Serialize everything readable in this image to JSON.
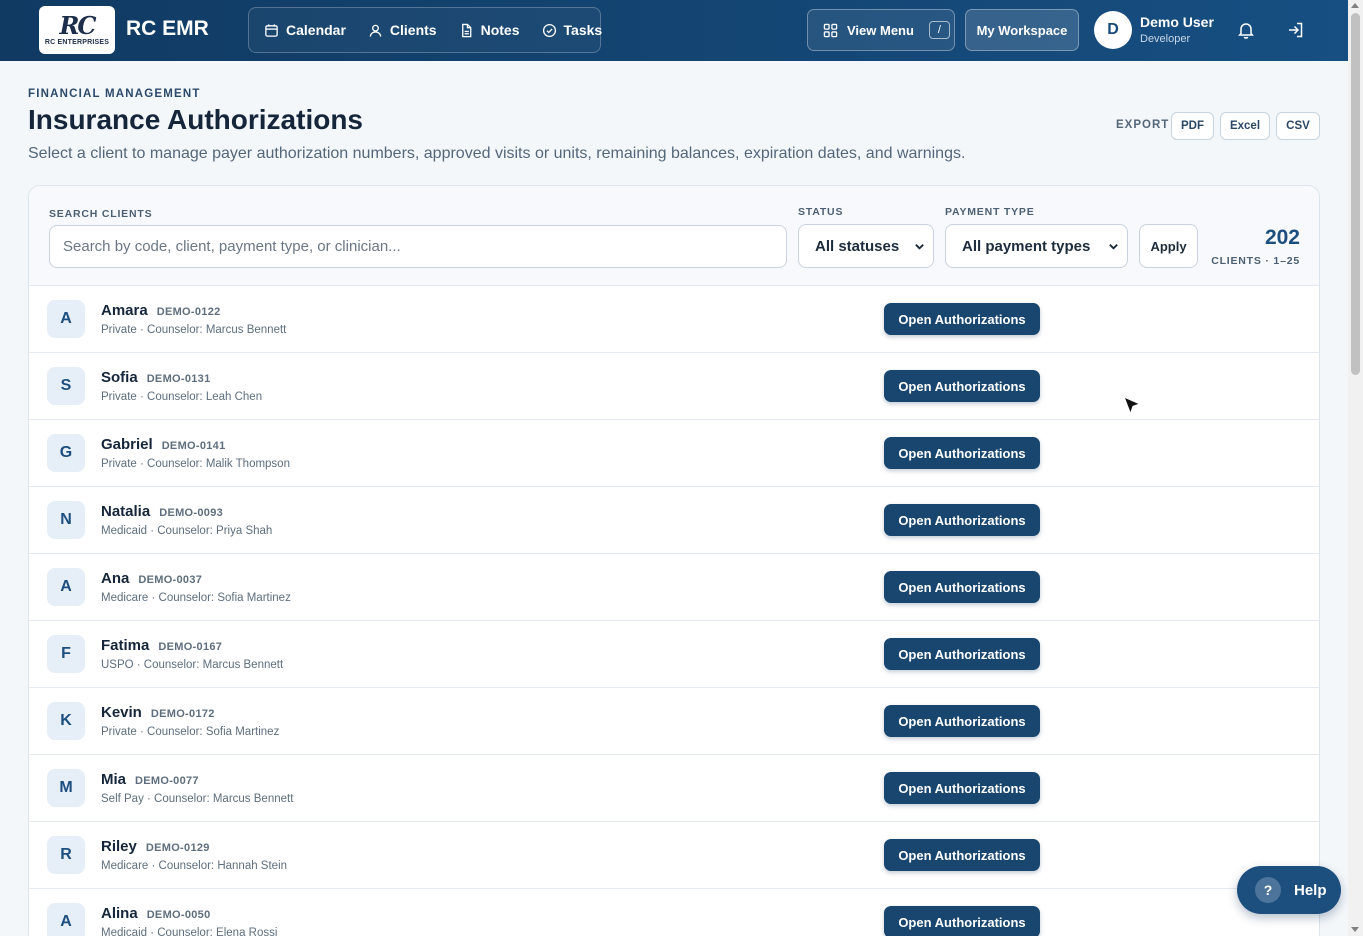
{
  "app": {
    "logo_letters": "RC",
    "logo_sub": "RC ENTERPRISES",
    "brand": "RC EMR"
  },
  "nav": {
    "items": [
      {
        "label": "Calendar",
        "icon": "calendar-icon"
      },
      {
        "label": "Clients",
        "icon": "user-icon"
      },
      {
        "label": "Notes",
        "icon": "document-icon"
      },
      {
        "label": "Tasks",
        "icon": "check-circle-icon"
      }
    ],
    "view_menu_label": "View Menu",
    "view_menu_shortcut": "/",
    "workspace_label": "My Workspace"
  },
  "user": {
    "initial": "D",
    "name": "Demo User",
    "role": "Developer"
  },
  "header": {
    "eyebrow": "FINANCIAL MANAGEMENT",
    "title": "Insurance Authorizations",
    "subtitle": "Select a client to manage payer authorization numbers, approved visits or units, remaining balances, expiration dates, and warnings.",
    "export_label": "EXPORT",
    "export_buttons": [
      "PDF",
      "Excel",
      "CSV"
    ]
  },
  "filters": {
    "search_label": "SEARCH CLIENTS",
    "search_placeholder": "Search by code, client, payment type, or clinician...",
    "status_label": "STATUS",
    "status_value": "All statuses",
    "payment_label": "PAYMENT TYPE",
    "payment_value": "All payment types",
    "apply_label": "Apply",
    "count": "202",
    "count_sub": "CLIENTS · 1–25"
  },
  "clients": [
    {
      "initial": "A",
      "name": "Amara",
      "code": "DEMO-0122",
      "meta": "Private · Counselor: Marcus Bennett"
    },
    {
      "initial": "S",
      "name": "Sofia",
      "code": "DEMO-0131",
      "meta": "Private · Counselor: Leah Chen"
    },
    {
      "initial": "G",
      "name": "Gabriel",
      "code": "DEMO-0141",
      "meta": "Private · Counselor: Malik Thompson"
    },
    {
      "initial": "N",
      "name": "Natalia",
      "code": "DEMO-0093",
      "meta": "Medicaid · Counselor: Priya Shah"
    },
    {
      "initial": "A",
      "name": "Ana",
      "code": "DEMO-0037",
      "meta": "Medicare · Counselor: Sofia Martinez"
    },
    {
      "initial": "F",
      "name": "Fatima",
      "code": "DEMO-0167",
      "meta": "USPO · Counselor: Marcus Bennett"
    },
    {
      "initial": "K",
      "name": "Kevin",
      "code": "DEMO-0172",
      "meta": "Private · Counselor: Sofia Martinez"
    },
    {
      "initial": "M",
      "name": "Mia",
      "code": "DEMO-0077",
      "meta": "Self Pay · Counselor: Marcus Bennett"
    },
    {
      "initial": "R",
      "name": "Riley",
      "code": "DEMO-0129",
      "meta": "Medicare · Counselor: Hannah Stein"
    },
    {
      "initial": "A",
      "name": "Alina",
      "code": "DEMO-0050",
      "meta": "Medicaid · Counselor: Elena Rossi"
    }
  ],
  "row_button_label": "Open Authorizations",
  "help_label": "Help",
  "help_glyph": "?",
  "colors": {
    "nav_bg": "#103a62",
    "primary": "#18466f",
    "accent": "#1c4e7e"
  }
}
